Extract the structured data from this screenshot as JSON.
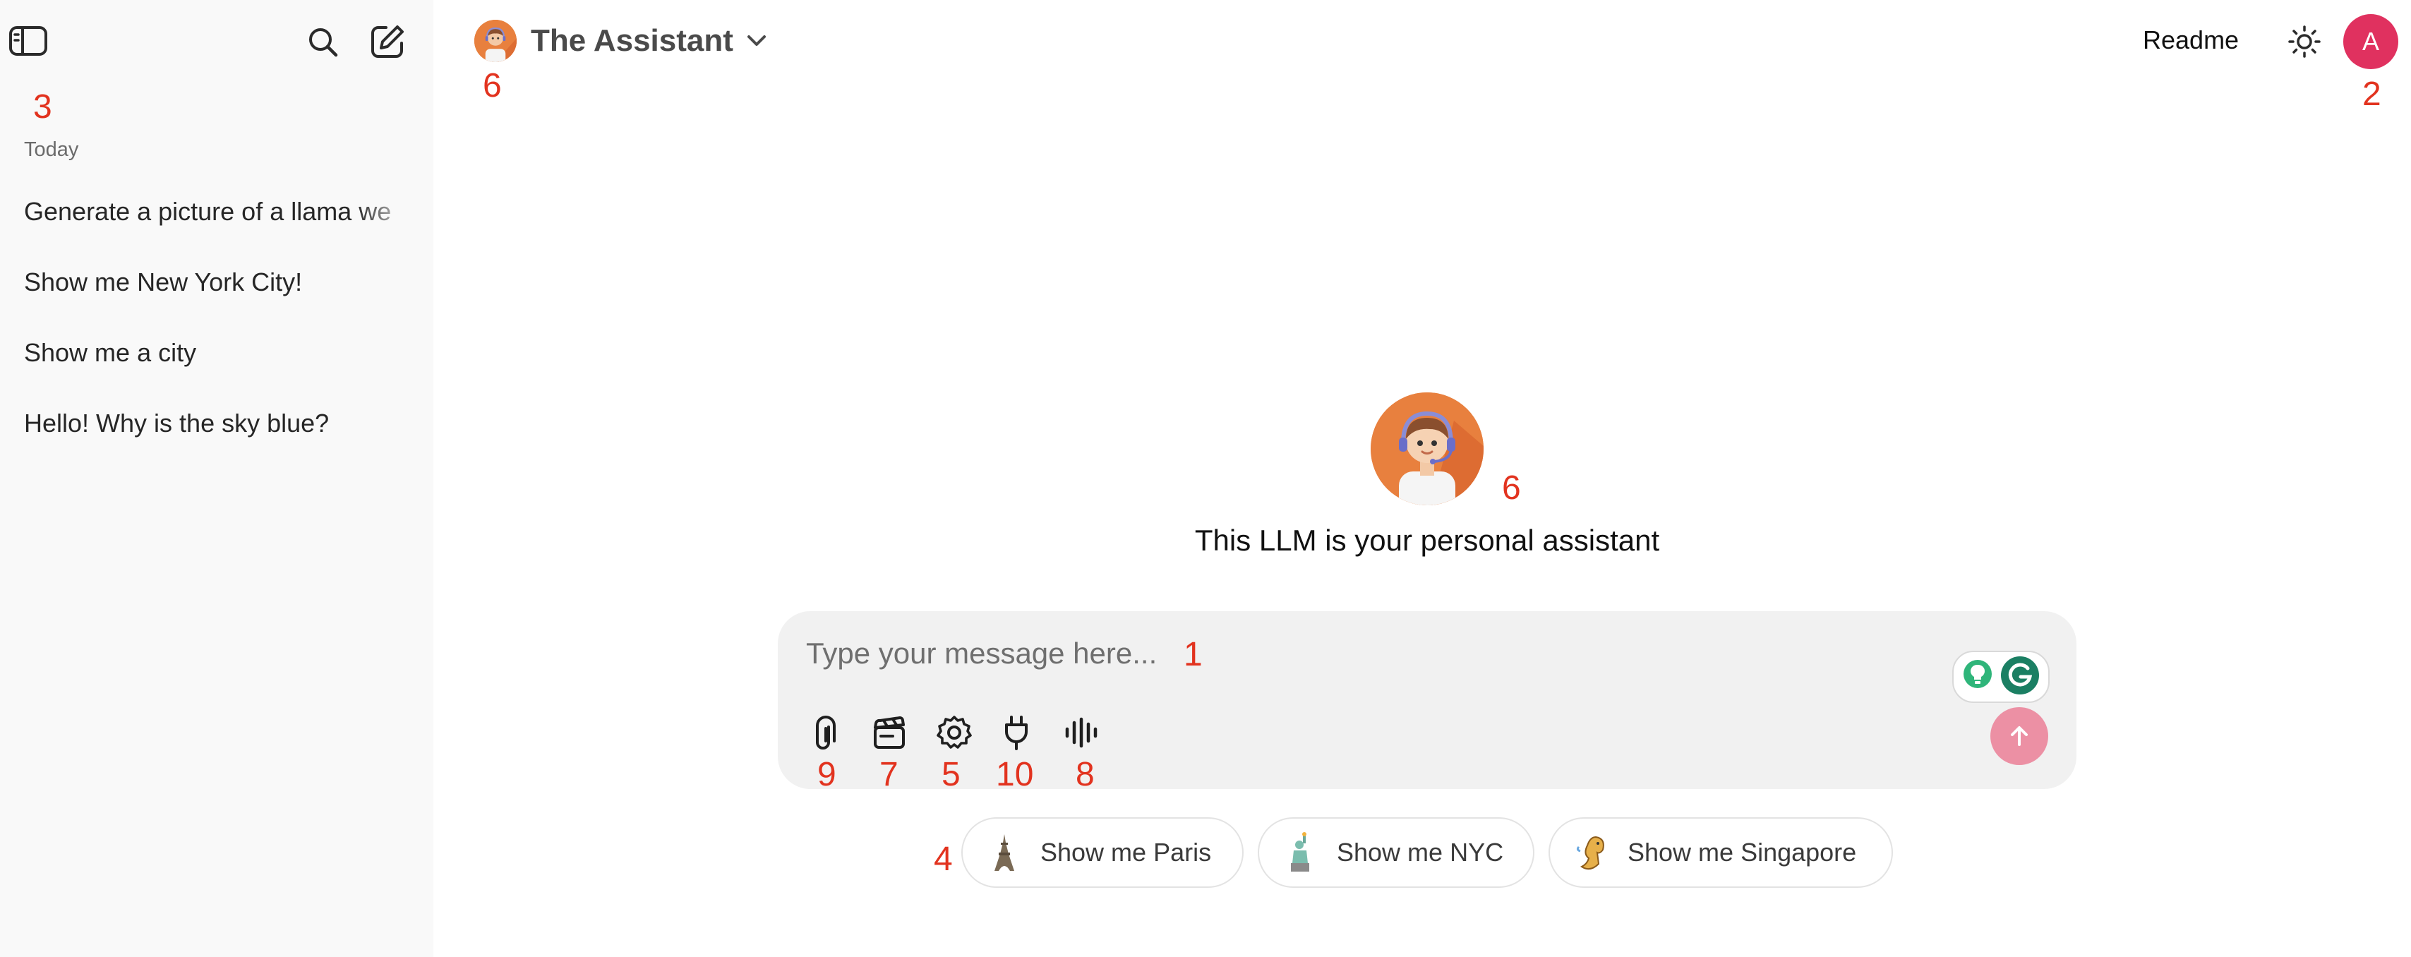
{
  "sidebar": {
    "icons": {
      "toggle": "sidebar-toggle-icon",
      "search": "search-icon",
      "new_chat": "new-chat-icon"
    },
    "group_label": "Today",
    "items": [
      {
        "label": "Generate a picture of a llama we"
      },
      {
        "label": "Show me New York City!"
      },
      {
        "label": "Show me a city"
      },
      {
        "label": "Hello! Why is the sky blue?"
      }
    ]
  },
  "header": {
    "model_name": "The Assistant",
    "readme_label": "Readme",
    "theme_icon": "sun-icon",
    "user_initial": "A"
  },
  "main": {
    "greeting": "This LLM is your personal assistant"
  },
  "composer": {
    "placeholder": "Type your message here...",
    "value": "",
    "tools": [
      "paperclip-icon",
      "clapperboard-icon",
      "gear-icon",
      "plug-icon",
      "voice-icon"
    ],
    "send_icon": "arrow-up-icon"
  },
  "suggestions": [
    {
      "label": "Show me Paris",
      "icon": "eiffel-tower-icon"
    },
    {
      "label": "Show me NYC",
      "icon": "statue-of-liberty-icon"
    },
    {
      "label": "Show me Singapore",
      "icon": "merlion-icon"
    }
  ],
  "annotations": {
    "sidebar": "3",
    "model_header": "6",
    "user_avatar": "2",
    "greeting_avatar": "6",
    "input": "1",
    "suggestions": "4",
    "attach": "9",
    "clapper": "7",
    "settings": "5",
    "plug": "10",
    "voice": "8"
  },
  "colors": {
    "sidebar_bg": "#f9f9f9",
    "composer_bg": "#f1f1f1",
    "accent_avatar": "#e0315f",
    "assistant_orange": "#e8803e",
    "send_button": "#ec90a4",
    "annotation": "#e2331f"
  }
}
